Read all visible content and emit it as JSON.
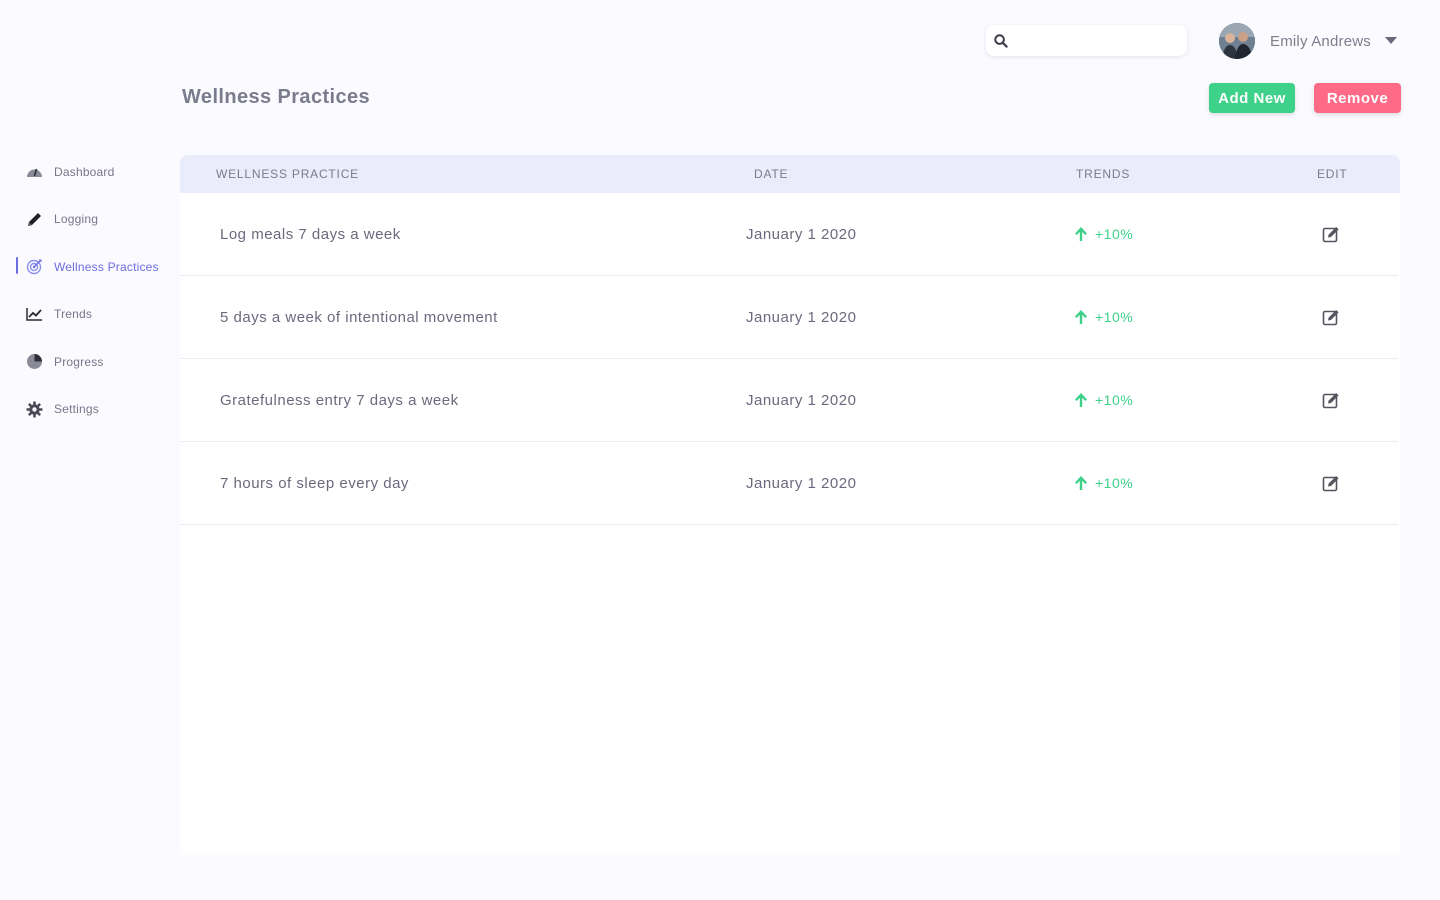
{
  "header": {
    "search": {
      "value": "",
      "placeholder": ""
    },
    "user": {
      "name": "Emily Andrews"
    },
    "title": "Wellness Practices",
    "add_label": "Add New",
    "remove_label": "Remove"
  },
  "sidebar": {
    "items": [
      {
        "label": "Dashboard",
        "icon": "dashboard-gauge-icon",
        "active": false
      },
      {
        "label": "Logging",
        "icon": "pencil-icon",
        "active": false
      },
      {
        "label": "Wellness Practices",
        "icon": "target-icon",
        "active": true
      },
      {
        "label": "Trends",
        "icon": "trend-line-icon",
        "active": false
      },
      {
        "label": "Progress",
        "icon": "pie-chart-icon",
        "active": false
      },
      {
        "label": "Settings",
        "icon": "gear-icon",
        "active": false
      }
    ]
  },
  "table": {
    "columns": {
      "practice": "WELLNESS PRACTICE",
      "date": "DATE",
      "trends": "TRENDS",
      "edit": "EDIT"
    },
    "rows": [
      {
        "practice": "Log meals 7 days a week",
        "date": "January 1 2020",
        "trend": "+10%"
      },
      {
        "practice": "5 days a week of intentional movement",
        "date": "January 1 2020",
        "trend": "+10%"
      },
      {
        "practice": "Gratefulness entry 7 days a week",
        "date": "January 1 2020",
        "trend": "+10%"
      },
      {
        "practice": "7 hours of sleep every day",
        "date": "January 1 2020",
        "trend": "+10%"
      }
    ]
  },
  "colors": {
    "accent": "#6b6ee0",
    "add_button": "#3dd18a",
    "remove_button": "#ff6b86",
    "trend_up": "#3dd18a",
    "table_header_bg": "#eaecfb"
  }
}
